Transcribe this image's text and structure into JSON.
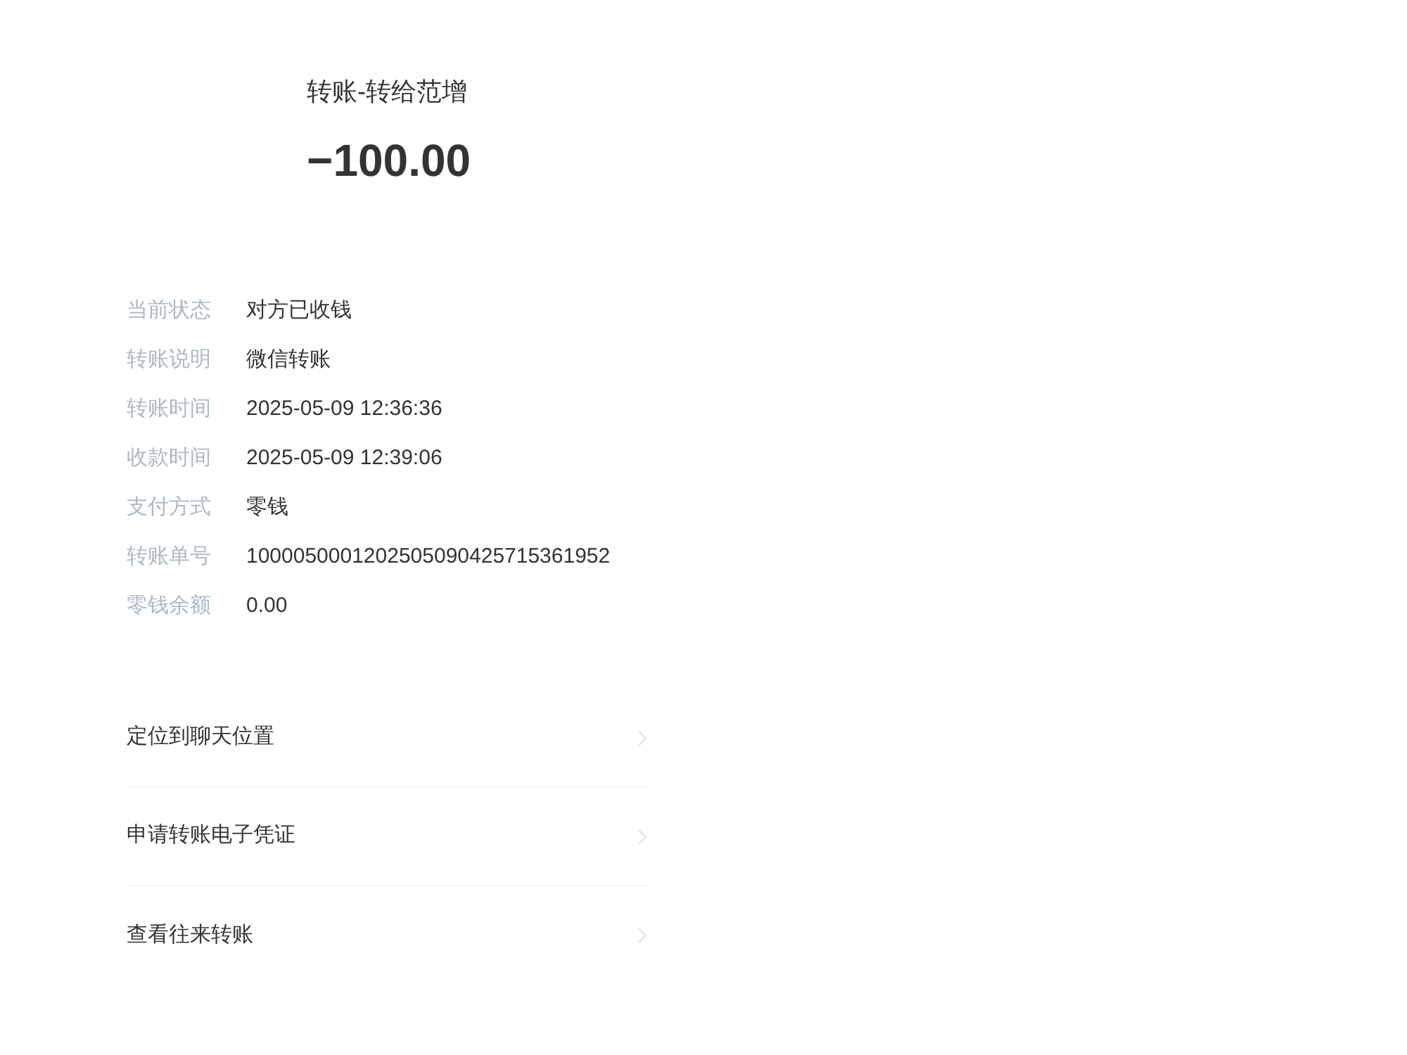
{
  "header": {
    "title": "转账-转给范增",
    "amount": "−100.00"
  },
  "details": [
    {
      "label": "当前状态",
      "value": "对方已收钱"
    },
    {
      "label": "转账说明",
      "value": "微信转账"
    },
    {
      "label": "转账时间",
      "value": "2025-05-09 12:36:36"
    },
    {
      "label": "收款时间",
      "value": "2025-05-09 12:39:06"
    },
    {
      "label": "支付方式",
      "value": "零钱"
    },
    {
      "label": "转账单号",
      "value": "1000050001202505090425715361952"
    },
    {
      "label": "零钱余额",
      "value": "0.00"
    }
  ],
  "actions": [
    {
      "label": "定位到聊天位置"
    },
    {
      "label": "申请转账电子凭证"
    },
    {
      "label": "查看往来转账"
    }
  ]
}
